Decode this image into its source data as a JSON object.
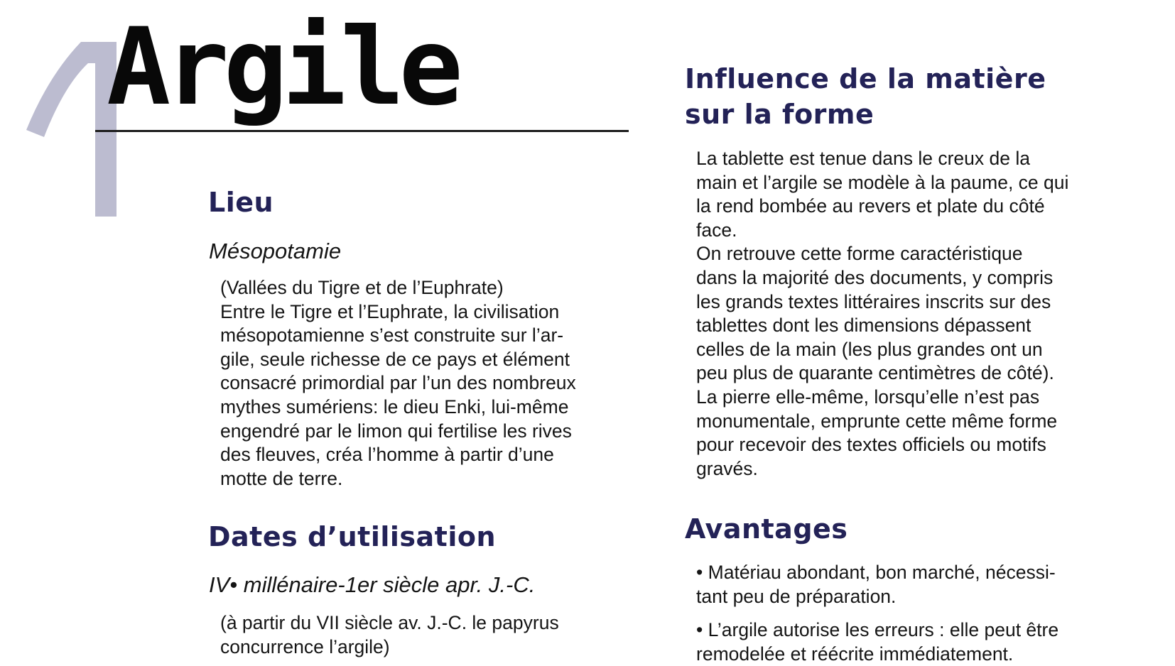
{
  "page_number": "1",
  "title": "Argile",
  "colors": {
    "heading": "#232257",
    "page_number": "#bcbcd0",
    "text": "#151515",
    "rule": "#1c1c1c"
  },
  "left_column": {
    "lieu": {
      "heading": "Lieu",
      "subheading": "Mésopotamie",
      "lines": [
        "(Vallées du Tigre et de l’Euphrate)",
        "Entre le Tigre et l’Euphrate, la civilisation",
        "mésopotamienne s’est construite sur l’ar-",
        "gile, seule richesse de ce pays et élément",
        "consacré primordial par l’un des nombreux",
        "mythes sumériens: le dieu Enki, lui-même",
        "engendré par le limon qui fertilise les rives",
        "des fleuves, créa l’homme à partir d’une",
        "motte de terre."
      ]
    },
    "dates": {
      "heading": "Dates d’utilisation",
      "subheading": "IV• millénaire-1er siècle apr. J.-C.",
      "lines": [
        "(à partir du VII siècle av. J.-C. le papyrus",
        "concurrence l’argile)"
      ]
    }
  },
  "right_column": {
    "influence": {
      "heading_lines": [
        "Influence de la matière",
        "sur la forme"
      ],
      "lines": [
        "La tablette est tenue dans le creux de la",
        "main et l’argile se modèle à la paume, ce qui",
        "la rend bombée au revers et plate du côté",
        "face.",
        "On retrouve cette forme caractéristique",
        "dans la majorité des documents, y compris",
        "les grands textes littéraires inscrits sur des",
        "tablettes dont les dimensions dépassent",
        "celles de la main (les plus grandes ont un",
        "peu plus de quarante centimètres de côté).",
        "La pierre elle-même, lorsqu’elle n’est pas",
        "monumentale, emprunte cette même forme",
        "pour recevoir des textes officiels ou motifs",
        "gravés."
      ]
    },
    "avantages": {
      "heading": "Avantages",
      "items": [
        [
          "• Matériau abondant, bon marché, nécessi-",
          "tant peu de préparation."
        ],
        [
          "• L’argile autorise les erreurs : elle peut être",
          "remodelée et réécrite immédiatement."
        ]
      ]
    }
  }
}
